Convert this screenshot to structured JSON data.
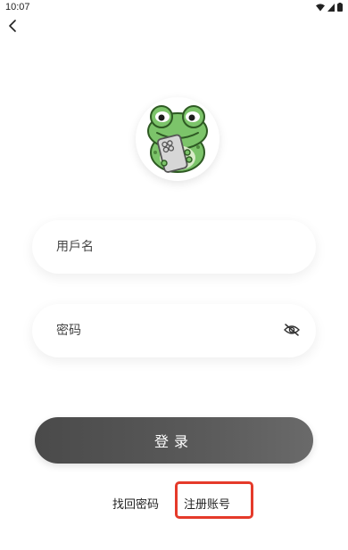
{
  "status_bar": {
    "time": "10:07",
    "icons": [
      "wifi-icon",
      "cell-signal-icon",
      "battery-icon"
    ]
  },
  "nav": {
    "back_icon": "chevron-left-icon"
  },
  "avatar": {
    "icon": "frog-mascot-icon"
  },
  "form": {
    "username": {
      "placeholder": "用戶名",
      "value": ""
    },
    "password": {
      "placeholder": "密码",
      "value": "",
      "toggle_icon": "eye-off-icon"
    },
    "login_label": "登录"
  },
  "links": {
    "forgot_password": "找回密码",
    "register": "注册账号"
  },
  "colors": {
    "login_button": "#4f4f4f",
    "highlight_border": "#e53a2a",
    "frog_green": "#7cc46a"
  }
}
